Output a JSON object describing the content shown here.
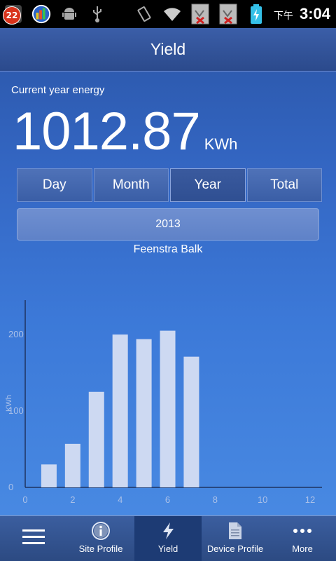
{
  "status_bar": {
    "notification_count": "22",
    "time_prefix": "下午",
    "time": "3:04",
    "icons": [
      "notification-badge-icon",
      "chart-app-icon",
      "android-debug-icon",
      "usb-icon",
      "vibrate-icon",
      "wifi-icon",
      "sim1-no-signal-icon",
      "sim2-no-signal-icon",
      "battery-charging-icon"
    ]
  },
  "header": {
    "title": "Yield"
  },
  "summary": {
    "label": "Current year energy",
    "value": "1012.87",
    "unit": "KWh"
  },
  "period_tabs": [
    {
      "label": "Day",
      "selected": false
    },
    {
      "label": "Month",
      "selected": false
    },
    {
      "label": "Year",
      "selected": true
    },
    {
      "label": "Total",
      "selected": false
    }
  ],
  "year_selector": {
    "value": "2013"
  },
  "site": {
    "name": "Feenstra Balk"
  },
  "chart_data": {
    "type": "bar",
    "x": [
      1,
      2,
      3,
      4,
      5,
      6,
      7
    ],
    "values": [
      30,
      57,
      125,
      200,
      194,
      205,
      171
    ],
    "ylabel": "KWh",
    "xlim": [
      0,
      12.5
    ],
    "ylim": [
      0,
      245
    ],
    "xticks": [
      0,
      2,
      4,
      6,
      8,
      10,
      12
    ],
    "yticks": [
      0,
      100,
      200
    ],
    "bar_color": "#cdd9f2"
  },
  "bottom_nav": {
    "items": [
      {
        "label": "",
        "icon": "menu-icon"
      },
      {
        "label": "Site Profile",
        "icon": "info-icon"
      },
      {
        "label": "Yield",
        "icon": "lightning-icon"
      },
      {
        "label": "Device Profile",
        "icon": "document-icon"
      },
      {
        "label": "More",
        "icon": "more-icon"
      }
    ]
  }
}
